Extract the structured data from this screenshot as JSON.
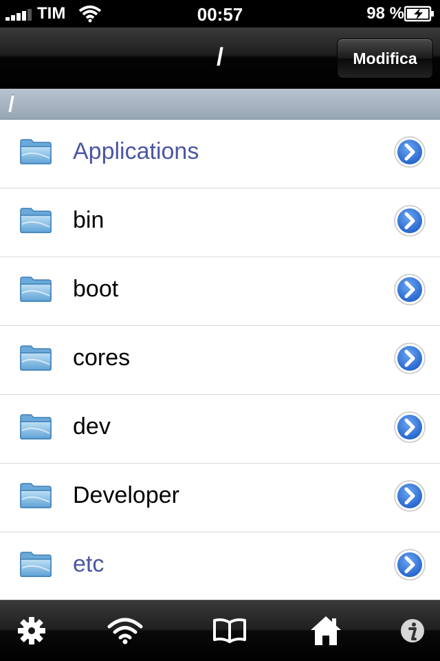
{
  "status_bar": {
    "carrier": "TIM",
    "time": "00:57",
    "battery": "98 %"
  },
  "nav": {
    "title": "/",
    "edit_label": "Modifica"
  },
  "path": "/",
  "folders": [
    {
      "name": "Applications",
      "style": "link"
    },
    {
      "name": "bin",
      "style": "normal"
    },
    {
      "name": "boot",
      "style": "normal"
    },
    {
      "name": "cores",
      "style": "normal"
    },
    {
      "name": "dev",
      "style": "normal"
    },
    {
      "name": "Developer",
      "style": "normal"
    },
    {
      "name": "etc",
      "style": "link"
    }
  ],
  "tabs": [
    {
      "icon": "gear-icon"
    },
    {
      "icon": "wifi-icon"
    },
    {
      "icon": "book-icon"
    },
    {
      "icon": "home-icon"
    },
    {
      "icon": "info-icon"
    }
  ],
  "colors": {
    "link_text": "#4a56a3",
    "disclosure_blue": "#2f6fd6"
  }
}
